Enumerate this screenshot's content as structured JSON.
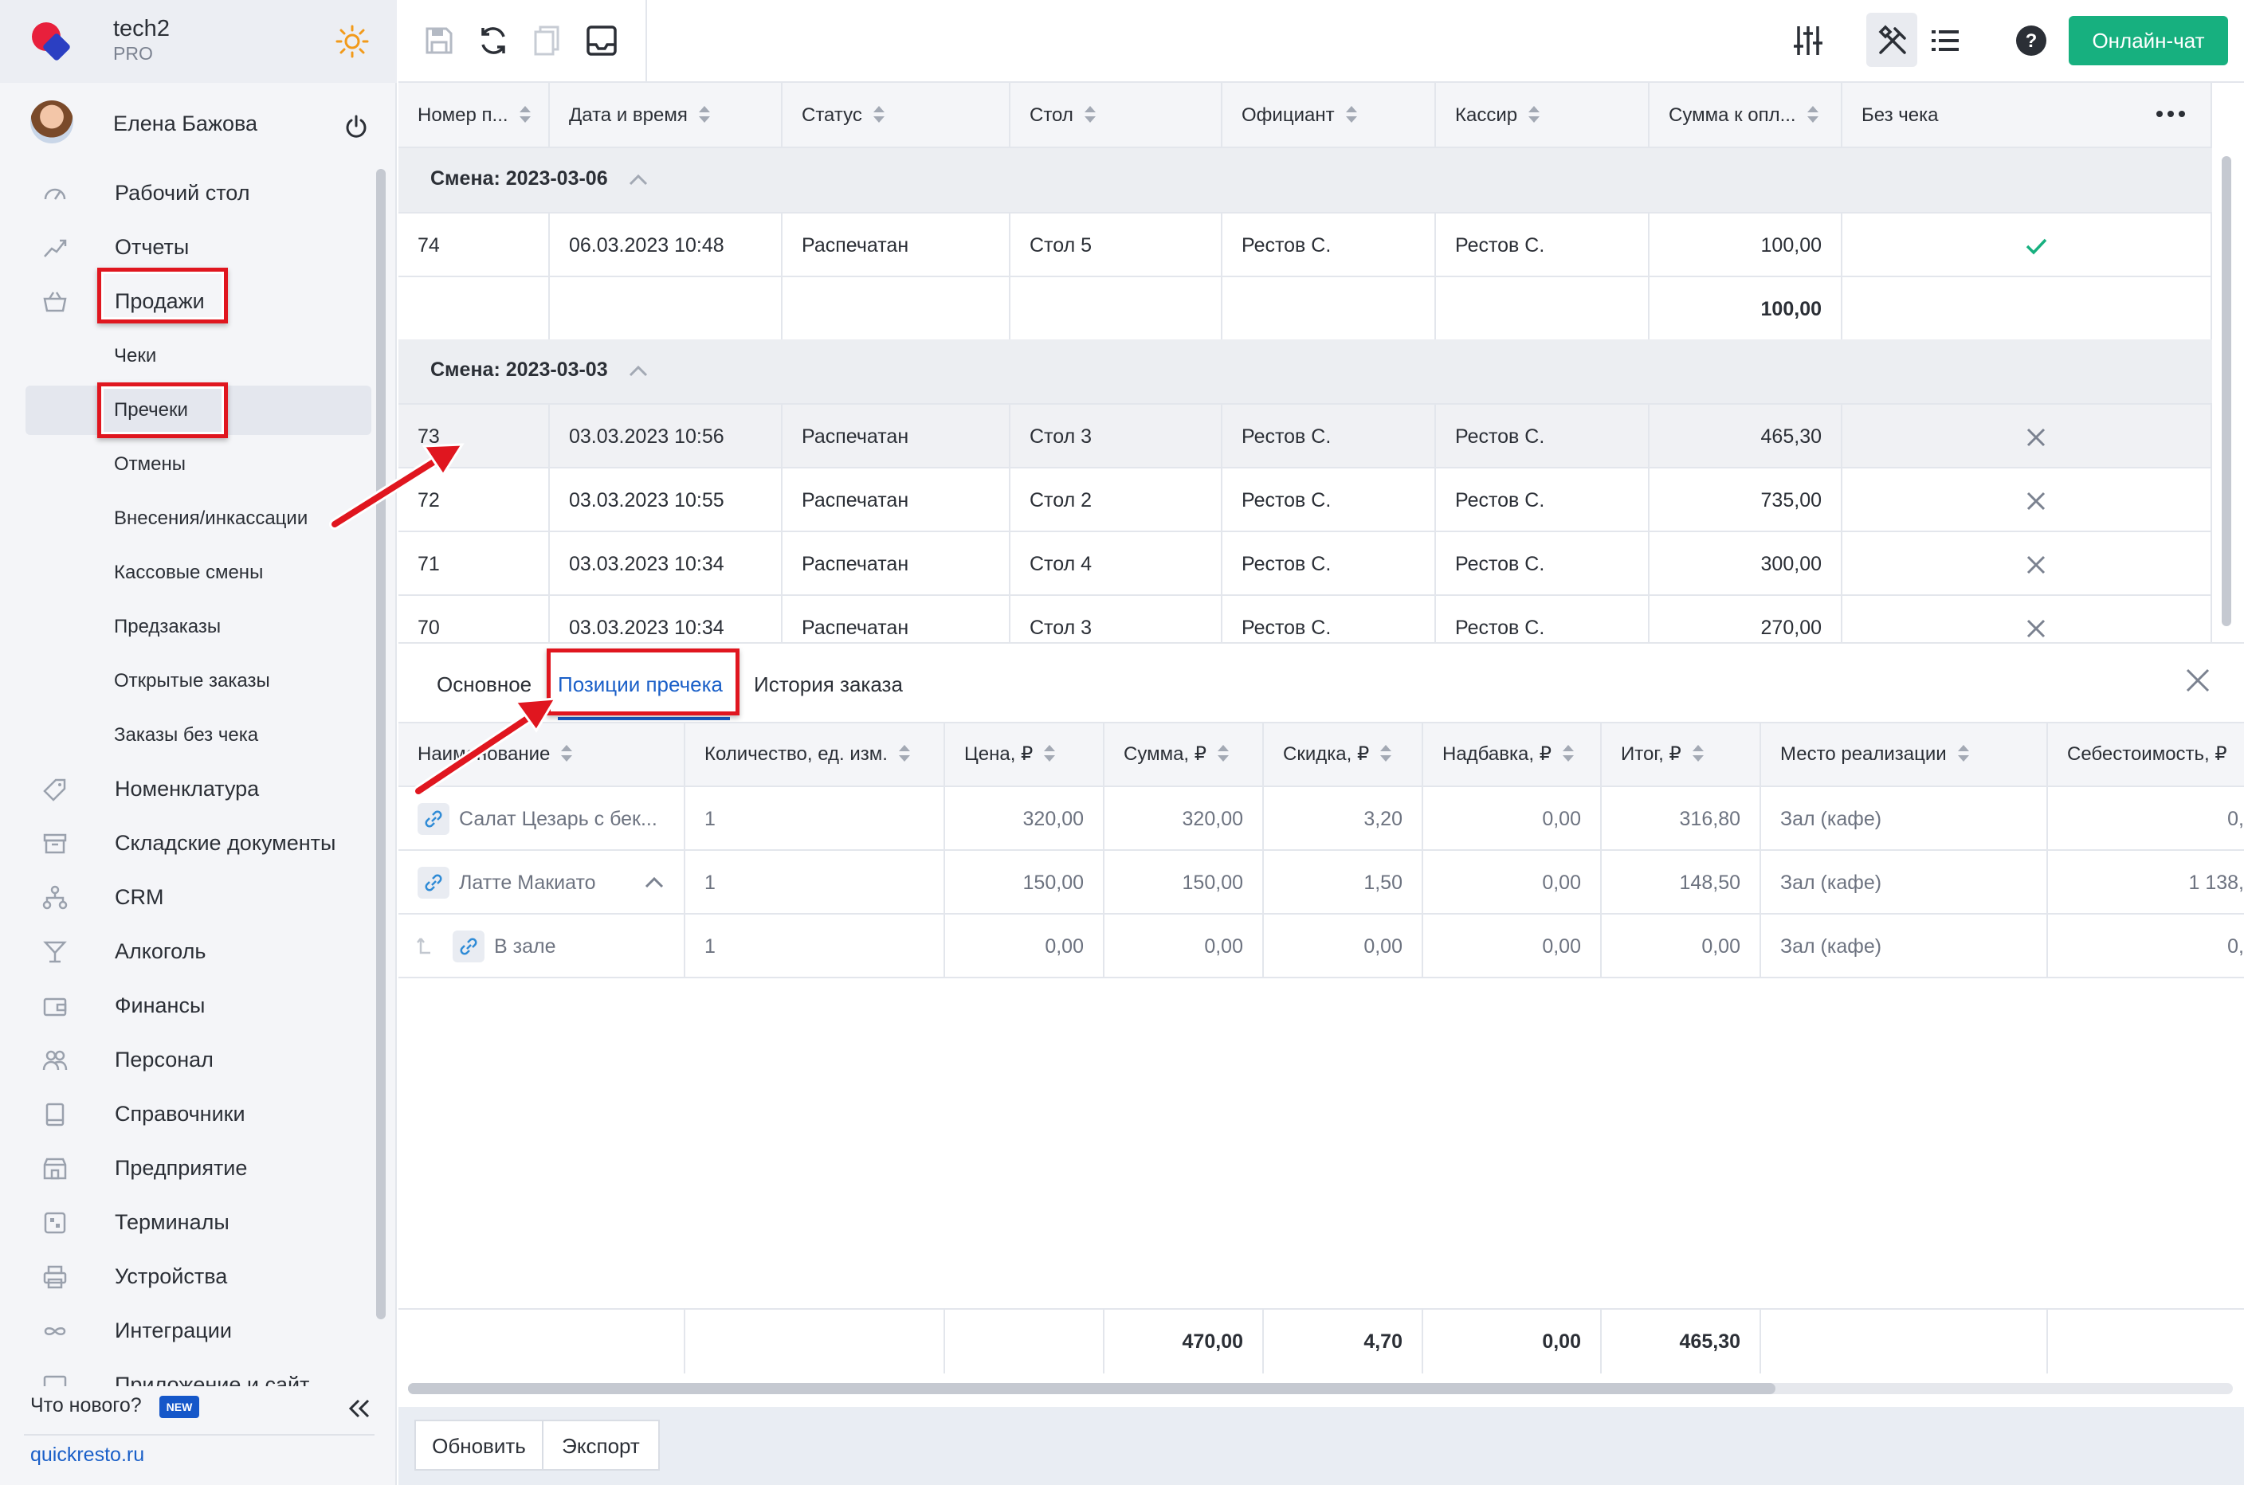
{
  "brand": {
    "name": "tech2",
    "plan": "PRO"
  },
  "user": {
    "name": "Елена Бажова"
  },
  "nav": {
    "desktop": "Рабочий стол",
    "reports": "Отчеты",
    "sales": "Продажи",
    "sales_sub": {
      "checks": "Чеки",
      "prechecks": "Пречеки",
      "cancellations": "Отмены",
      "cash_ops": "Внесения/инкассации",
      "shifts": "Кассовые смены",
      "preorders": "Предзаказы",
      "open_orders": "Открытые заказы",
      "no_check": "Заказы без чека"
    },
    "nomenclature": "Номенклатура",
    "warehouse": "Складские документы",
    "crm": "CRM",
    "alcohol": "Алкоголь",
    "finance": "Финансы",
    "staff": "Персонал",
    "references": "Справочники",
    "enterprise": "Предприятие",
    "terminals": "Терминалы",
    "devices": "Устройства",
    "integrations": "Интеграции",
    "app": "Приложение и сайт"
  },
  "footer": {
    "whats_new": "Что нового?",
    "badge": "NEW",
    "site": "quickresto.ru"
  },
  "toolbar": {
    "chat": "Онлайн-чат"
  },
  "table": {
    "columns": [
      "Номер п...",
      "Дата и время",
      "Статус",
      "Стол",
      "Официант",
      "Кассир",
      "Сумма к опл...",
      "Без чека"
    ],
    "groups": [
      {
        "label": "Смена: 2023-03-06",
        "rows": [
          {
            "num": "74",
            "dt": "06.03.2023 10:48",
            "status": "Распечатан",
            "table": "Стол 5",
            "waiter": "Рестов С.",
            "cashier": "Рестов С.",
            "sum": "100,00",
            "no_check": true
          }
        ],
        "total": "100,00"
      },
      {
        "label": "Смена: 2023-03-03",
        "rows": [
          {
            "num": "73",
            "dt": "03.03.2023 10:56",
            "status": "Распечатан",
            "table": "Стол 3",
            "waiter": "Рестов С.",
            "cashier": "Рестов С.",
            "sum": "465,30",
            "no_check": false
          },
          {
            "num": "72",
            "dt": "03.03.2023 10:55",
            "status": "Распечатан",
            "table": "Стол 2",
            "waiter": "Рестов С.",
            "cashier": "Рестов С.",
            "sum": "735,00",
            "no_check": false
          },
          {
            "num": "71",
            "dt": "03.03.2023 10:34",
            "status": "Распечатан",
            "table": "Стол 4",
            "waiter": "Рестов С.",
            "cashier": "Рестов С.",
            "sum": "300,00",
            "no_check": false
          },
          {
            "num": "70",
            "dt": "03.03.2023 10:34",
            "status": "Распечатан",
            "table": "Стол 3",
            "waiter": "Рестов С.",
            "cashier": "Рестов С.",
            "sum": "270,00",
            "no_check": false
          }
        ]
      }
    ]
  },
  "details": {
    "tabs": [
      "Основное",
      "Позиции пречека",
      "История заказа"
    ],
    "columns": [
      "Наименование",
      "Количество, ед. изм.",
      "Цена, ₽",
      "Сумма, ₽",
      "Скидка, ₽",
      "Надбавка, ₽",
      "Итог, ₽",
      "Место реализации",
      "Себестоимость, ₽"
    ],
    "rows": [
      {
        "name": "Салат Цезарь с бек...",
        "qty": "1",
        "price": "320,00",
        "sum": "320,00",
        "discount": "3,20",
        "markup": "0,00",
        "total": "316,80",
        "place": "Зал (кафе)",
        "cost": "0,"
      },
      {
        "name": "Латте Макиато",
        "qty": "1",
        "price": "150,00",
        "sum": "150,00",
        "discount": "1,50",
        "markup": "0,00",
        "total": "148,50",
        "place": "Зал (кафе)",
        "cost": "1 138,"
      },
      {
        "name": "В зале",
        "qty": "1",
        "price": "0,00",
        "sum": "0,00",
        "discount": "0,00",
        "markup": "0,00",
        "total": "0,00",
        "place": "Зал (кафе)",
        "cost": "0,"
      }
    ],
    "totals": {
      "sum": "470,00",
      "discount": "4,70",
      "markup": "0,00",
      "total": "465,30"
    }
  },
  "bottom": {
    "refresh": "Обновить",
    "export": "Экспорт"
  },
  "colors": {
    "accent": "#1a5fc8",
    "chat": "#17b07f",
    "highlight": "#e0161f",
    "check": "#17b07f"
  }
}
